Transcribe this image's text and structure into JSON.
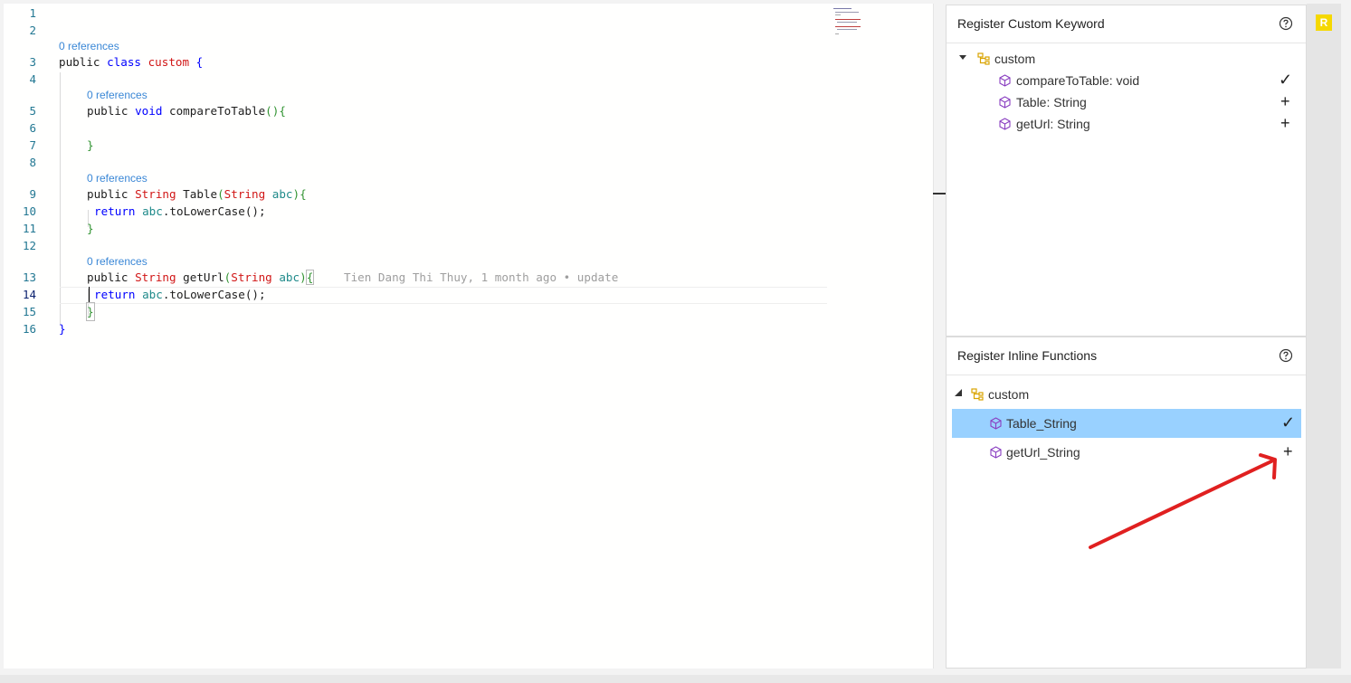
{
  "editor": {
    "line_numbers": [
      "1",
      "2",
      "3",
      "4",
      "5",
      "6",
      "7",
      "8",
      "9",
      "10",
      "11",
      "12",
      "13",
      "14",
      "15",
      "16"
    ],
    "codelens": {
      "ref1": "0 references",
      "ref2": "0 references",
      "ref3": "0 references",
      "ref4": "0 references"
    },
    "code": {
      "l3_public": "public ",
      "l3_class": "class ",
      "l3_name": "custom",
      "l3_brace": " {",
      "l5_public": "public ",
      "l5_void": "void ",
      "l5_name": "compareToTable",
      "l5_parens": "(){",
      "l7_brace": "}",
      "l9_public": "public ",
      "l9_type": "String",
      "l9_name": " Table",
      "l9_open": "(",
      "l9_ptype": "String",
      "l9_param": " abc",
      "l9_close": "){",
      "l10_return": "return ",
      "l10_abc": "abc",
      "l10_rest": ".toLowerCase();",
      "l11_brace": "}",
      "l13_public": "public ",
      "l13_type": "String",
      "l13_name": " getUrl",
      "l13_open": "(",
      "l13_ptype": "String",
      "l13_param": " abc",
      "l13_close": ")",
      "l13_brace": "{",
      "l14_return": "return ",
      "l14_abc": "abc",
      "l14_rest": ".toLowerCase();",
      "l15_brace": "}",
      "l16_brace": "}"
    },
    "blame": "Tien Dang Thi Thuy, 1 month ago • update"
  },
  "keyword_panel": {
    "title": "Register Custom Keyword",
    "root": "custom",
    "items": [
      {
        "label": "compareToTable: void",
        "action": "✓"
      },
      {
        "label": "Table: String",
        "action": "+"
      },
      {
        "label": "getUrl: String",
        "action": "+"
      }
    ]
  },
  "inline_panel": {
    "title": "Register Inline Functions",
    "root": "custom",
    "items": [
      {
        "label": "Table_String",
        "action": "✓"
      },
      {
        "label": "getUrl_String",
        "action": "+"
      }
    ]
  },
  "right_strip": {
    "badge": "R"
  },
  "colors": {
    "selected_row": "#99d1ff",
    "badge": "#f5d800",
    "arrow": "#e02020",
    "codelens": "#3a87d6"
  }
}
